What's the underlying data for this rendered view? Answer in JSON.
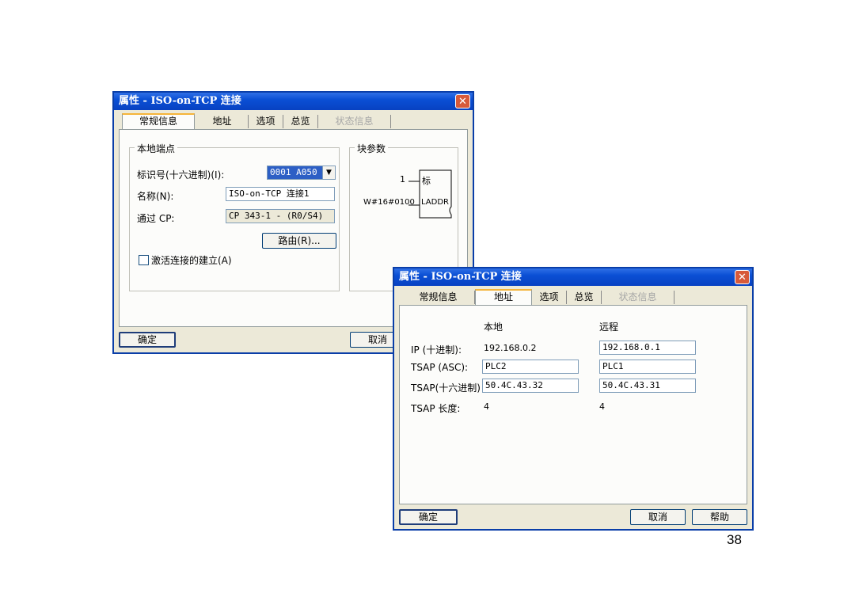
{
  "dialog1": {
    "title": "属性 - ISO-on-TCP 连接",
    "close_glyph": "✕",
    "tabs": [
      {
        "label": "常规信息"
      },
      {
        "label": "地址"
      },
      {
        "label": "选项"
      },
      {
        "label": "总览"
      },
      {
        "label": "状态信息"
      }
    ],
    "local_group_title": "本地端点",
    "id_label": "标识号(十六进制)(I):",
    "id_value": "0001 A050",
    "dropdown_glyph": "▼",
    "name_label": "名称(N):",
    "name_value": "ISO-on-TCP 连接1",
    "via_cp_label": "通过 CP:",
    "via_cp_value": "CP 343-1 - (R0/S4)",
    "route_button": "路由(R)...",
    "active_checkbox_label": "激活连接的建立(A)",
    "block_group_title": "块参数",
    "block_id_value": "1",
    "block_id_label": "标",
    "block_laddr_value": "W#16#0100",
    "block_laddr_label": "LADDR",
    "ok_button": "确定",
    "cancel_button": "取消"
  },
  "dialog2": {
    "title": "属性 - ISO-on-TCP 连接",
    "close_glyph": "✕",
    "tabs": [
      {
        "label": "常规信息"
      },
      {
        "label": "地址"
      },
      {
        "label": "选项"
      },
      {
        "label": "总览"
      },
      {
        "label": "状态信息"
      }
    ],
    "col_local": "本地",
    "col_remote": "远程",
    "ip_label": "IP (十进制):",
    "ip_local": "192.168.0.2",
    "ip_remote": "192.168.0.1",
    "tsap_asc_label": "TSAP (ASC):",
    "tsap_asc_local": "PLC2",
    "tsap_asc_remote": "PLC1",
    "tsap_hex_label": "TSAP(十六进制)",
    "tsap_hex_local": "50.4C.43.32",
    "tsap_hex_remote": "50.4C.43.31",
    "tsap_len_label": "TSAP 长度:",
    "tsap_len_local": "4",
    "tsap_len_remote": "4",
    "ok_button": "确定",
    "cancel_button": "取消",
    "help_button": "帮助"
  },
  "page_number": "38"
}
